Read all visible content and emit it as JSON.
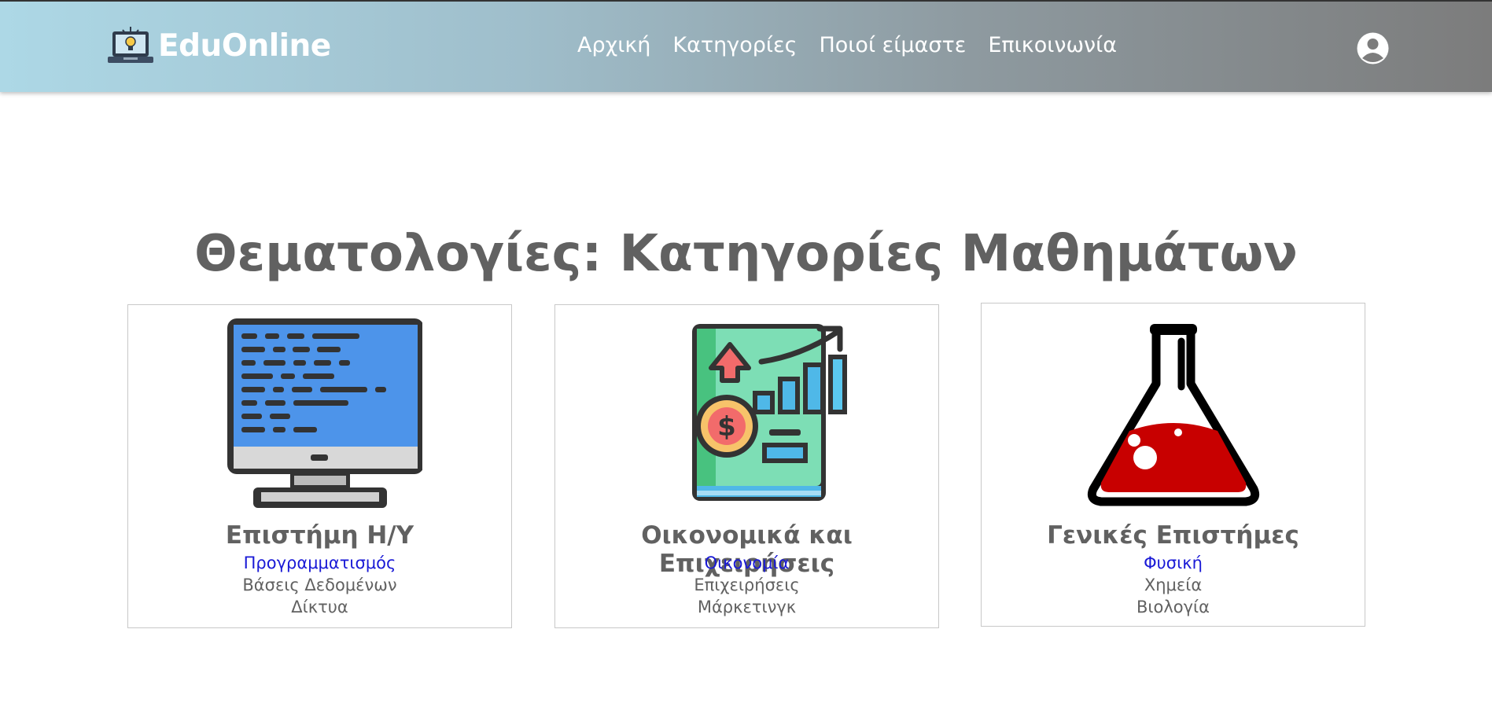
{
  "brand": {
    "name": "EduOnline"
  },
  "nav": {
    "items": [
      {
        "label": "Αρχική"
      },
      {
        "label": "Κατηγορίες"
      },
      {
        "label": "Ποιοί είμαστε"
      },
      {
        "label": "Επικοινωνία"
      }
    ]
  },
  "main": {
    "title": "Θεματολογίες: Κατηγορίες Μαθημάτων",
    "cards": [
      {
        "title": "Επιστήμη Η/Υ",
        "links": [
          "Προγραμματισμός",
          "Βάσεις Δεδομένων",
          "Δίκτυα"
        ]
      },
      {
        "title": "Οικονομικά και Επιχειρήσεις",
        "links": [
          "Οικονομία",
          "Επιχειρήσεις",
          "Μάρκετινγκ"
        ]
      },
      {
        "title": "Γενικές Επιστήμες",
        "links": [
          "Φυσική",
          "Χημεία",
          "Βιολογία"
        ]
      }
    ]
  },
  "colors": {
    "link_active": "#1a1ad6",
    "text": "#616161",
    "nav_gradient_start": "#add8e6",
    "nav_gradient_end": "#7c7c7c"
  }
}
